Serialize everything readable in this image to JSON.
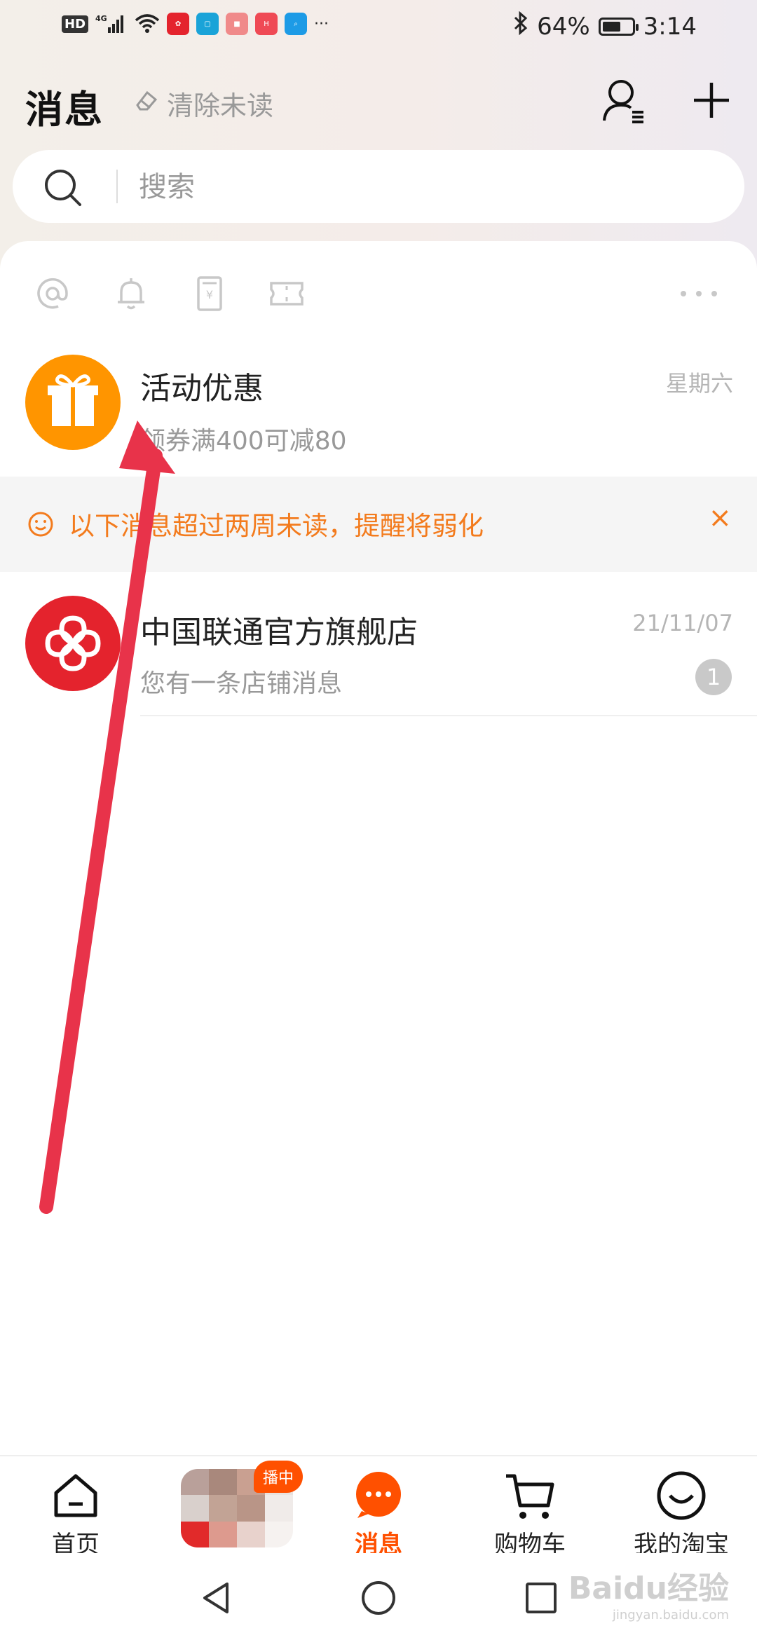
{
  "status_bar": {
    "network": "4G",
    "hd_label": "HD",
    "battery_percent": "64%",
    "battery_level": 0.64,
    "time": "3:14",
    "more": "···"
  },
  "header": {
    "title": "消息",
    "clear_label": "清除未读"
  },
  "search": {
    "placeholder": "搜索"
  },
  "quick_icons": [
    "at-icon",
    "bell-icon",
    "coupon-icon",
    "ticket-icon",
    "more-icon"
  ],
  "messages": [
    {
      "name": "活动优惠",
      "preview": "领券满400可减80",
      "time": "星期六",
      "avatar": "gift-icon",
      "avatar_color": "#ff9500"
    },
    {
      "name": "中国联通官方旗舰店",
      "preview": "您有一条店铺消息",
      "time": "21/11/07",
      "unread": "1",
      "avatar": "china-unicom-logo",
      "avatar_color": "#e4232d"
    }
  ],
  "notice": {
    "text": "以下消息超过两周未读，提醒将弱化",
    "close": "×",
    "color": "#f37b1d"
  },
  "tabbar": {
    "home": "首页",
    "live_tag": "播中",
    "messages": "消息",
    "cart": "购物车",
    "mine": "我的淘宝",
    "active_color": "#ff5000"
  },
  "watermark": {
    "text": "Baidu经验",
    "sub": "jingyan.baidu.com"
  }
}
